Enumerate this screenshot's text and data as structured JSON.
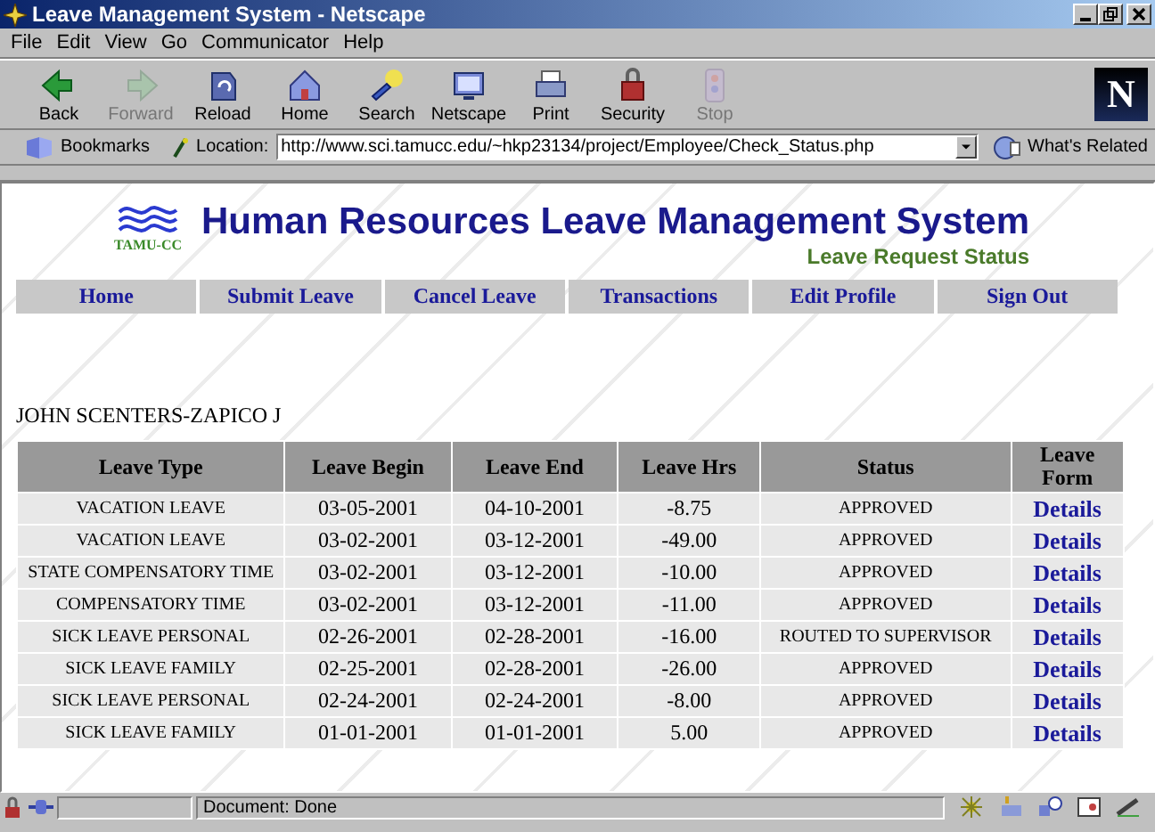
{
  "window": {
    "title": "Leave Management System - Netscape"
  },
  "menu": [
    "File",
    "Edit",
    "View",
    "Go",
    "Communicator",
    "Help"
  ],
  "toolbar": {
    "buttons": [
      {
        "kind": "back",
        "label": "Back",
        "disabled": false
      },
      {
        "kind": "forward",
        "label": "Forward",
        "disabled": true
      },
      {
        "kind": "reload",
        "label": "Reload",
        "disabled": false
      },
      {
        "kind": "home",
        "label": "Home",
        "disabled": false
      },
      {
        "kind": "search",
        "label": "Search",
        "disabled": false
      },
      {
        "kind": "portal",
        "label": "Netscape",
        "disabled": false
      },
      {
        "kind": "print",
        "label": "Print",
        "disabled": false
      },
      {
        "kind": "security",
        "label": "Security",
        "disabled": false
      },
      {
        "kind": "stop",
        "label": "Stop",
        "disabled": true
      }
    ],
    "logo": "N"
  },
  "location": {
    "bookmarks": "Bookmarks",
    "label": "Location:",
    "url": "http://www.sci.tamucc.edu/~hkp23134/project/Employee/Check_Status.php",
    "related": "What's Related"
  },
  "page": {
    "logo_text": "TAMU-CC",
    "title": "Human Resources Leave Management System",
    "subtitle": "Leave Request Status",
    "nav": [
      "Home",
      "Submit Leave",
      "Cancel Leave",
      "Transactions",
      "Edit Profile",
      "Sign Out"
    ],
    "employee": "JOHN SCENTERS-ZAPICO J",
    "table": {
      "columns": [
        "Leave Type",
        "Leave Begin",
        "Leave End",
        "Leave Hrs",
        "Status",
        "Leave Form"
      ],
      "rows": [
        {
          "type": "VACATION LEAVE",
          "begin": "03-05-2001",
          "end": "04-10-2001",
          "hours": "-8.75",
          "status": "APPROVED",
          "form": "Details"
        },
        {
          "type": "VACATION LEAVE",
          "begin": "03-02-2001",
          "end": "03-12-2001",
          "hours": "-49.00",
          "status": "APPROVED",
          "form": "Details"
        },
        {
          "type": "STATE COMPENSATORY TIME",
          "begin": "03-02-2001",
          "end": "03-12-2001",
          "hours": "-10.00",
          "status": "APPROVED",
          "form": "Details"
        },
        {
          "type": "COMPENSATORY TIME",
          "begin": "03-02-2001",
          "end": "03-12-2001",
          "hours": "-11.00",
          "status": "APPROVED",
          "form": "Details"
        },
        {
          "type": "SICK LEAVE PERSONAL",
          "begin": "02-26-2001",
          "end": "02-28-2001",
          "hours": "-16.00",
          "status": "ROUTED TO SUPERVISOR",
          "form": "Details"
        },
        {
          "type": "SICK LEAVE FAMILY",
          "begin": "02-25-2001",
          "end": "02-28-2001",
          "hours": "-26.00",
          "status": "APPROVED",
          "form": "Details"
        },
        {
          "type": "SICK LEAVE PERSONAL",
          "begin": "02-24-2001",
          "end": "02-24-2001",
          "hours": "-8.00",
          "status": "APPROVED",
          "form": "Details"
        },
        {
          "type": "SICK LEAVE FAMILY",
          "begin": "01-01-2001",
          "end": "01-01-2001",
          "hours": "5.00",
          "status": "APPROVED",
          "form": "Details"
        }
      ]
    }
  },
  "status_bar": {
    "text": "Document: Done"
  }
}
